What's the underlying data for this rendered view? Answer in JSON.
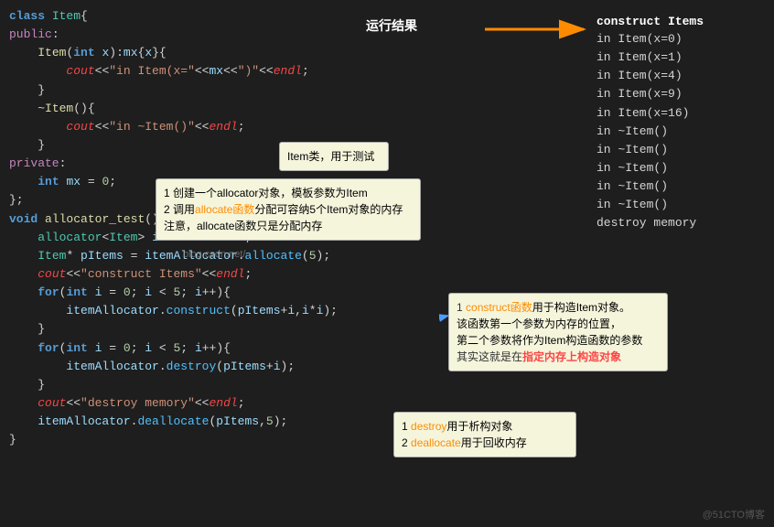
{
  "code": {
    "lines": [
      {
        "text": "class Item{",
        "type": "class-decl"
      },
      {
        "text": "public:",
        "type": "access"
      },
      {
        "text": "    Item(int x):mx{x}{",
        "type": "normal"
      },
      {
        "text": "        cout<<\"in Item(x=\"<<mx<<\")\"<<endl;",
        "type": "cout"
      },
      {
        "text": "    }",
        "type": "normal"
      },
      {
        "text": "    ~Item(){",
        "type": "destructor"
      },
      {
        "text": "        cout<<\"in ~Item()\"<<endl;",
        "type": "cout"
      },
      {
        "text": "    }",
        "type": "normal"
      },
      {
        "text": "private:",
        "type": "access"
      },
      {
        "text": "    int mx = 0;",
        "type": "normal"
      },
      {
        "text": "};",
        "type": "normal"
      },
      {
        "text": "void allocator_test(){",
        "type": "fn-decl"
      },
      {
        "text": "    allocator<Item> itemAllocator;",
        "type": "normal"
      },
      {
        "text": "    Item* pItems = itemAllocator.allocate(5);",
        "type": "normal"
      },
      {
        "text": "    cout<<\"construct Items\"<<endl;",
        "type": "cout"
      },
      {
        "text": "    for(int i = 0; i < 5; i++){",
        "type": "for"
      },
      {
        "text": "        itemAllocator.construct(pItems+i,i*i);",
        "type": "construct"
      },
      {
        "text": "    }",
        "type": "normal"
      },
      {
        "text": "    for(int i = 0; i < 5; i++){",
        "type": "for"
      },
      {
        "text": "        itemAllocator.destroy(pItems+i);",
        "type": "destroy"
      },
      {
        "text": "    }",
        "type": "normal"
      },
      {
        "text": "    cout<<\"destroy memory\"<<endl;",
        "type": "cout"
      },
      {
        "text": "    itemAllocator.deallocate(pItems,5);",
        "type": "normal"
      },
      {
        "text": "}",
        "type": "normal"
      }
    ]
  },
  "results": {
    "header": "construct Items",
    "lines": [
      "in Item(x=0)",
      "in Item(x=1)",
      "in Item(x=4)",
      "in Item(x=9)",
      "in Item(x=16)",
      "in ~Item()",
      "in ~Item()",
      "in ~Item()",
      "in ~Item()",
      "in ~Item()",
      "destroy memory"
    ]
  },
  "labels": {
    "runtime": "运行结果",
    "item_class_tooltip": "Item类，用于测试",
    "allocator_tooltip_line1": "1 创建一个allocator对象，模板参数为Item",
    "allocator_tooltip_line2": "2 调用allocate函数分配可容纳5个Item对象的内存",
    "allocator_tooltip_line3": "注意，allocate函数只是分配内存",
    "construct_tooltip_line1": "1 construct函数用于构造Item对象。",
    "construct_tooltip_line2": "该函数第一个参数为内存的位置，",
    "construct_tooltip_line3": "第二个参数将作为Item构造函数的参数",
    "construct_tooltip_line4": "其实这就是在指定内存上构造对象",
    "destroy_tooltip_line1": "1 destroy用于析构对象",
    "destroy_tooltip_line2": "2 deallocate用于回收内存",
    "watermark": "@51CTO博客",
    "blog_watermark": "blog.csdn.net/"
  }
}
